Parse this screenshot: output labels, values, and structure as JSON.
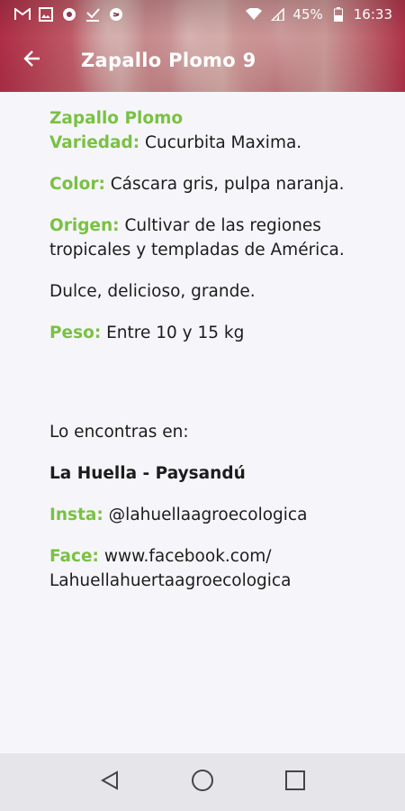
{
  "status_bar": {
    "battery": "45%",
    "time": "16:33",
    "icons": [
      "gmail-icon",
      "image-icon",
      "app-icon",
      "download-icon",
      "shazam-icon",
      "wifi-icon",
      "signal-icon",
      "battery-icon"
    ]
  },
  "appbar": {
    "title": "Zapallo Plomo 9"
  },
  "content": {
    "heading": "Zapallo Plomo",
    "variedad_label": "Variedad:",
    "variedad_value": " Cucurbita Maxima.",
    "color_label": "Color:",
    "color_value": " Cáscara gris, pulpa naranja.",
    "origen_label": "Origen:",
    "origen_value": " Cultivar de las regiones tropicales y templadas de América.",
    "description": "Dulce, delicioso, grande.",
    "peso_label": "Peso:",
    "peso_value": " Entre 10 y 15 kg",
    "found_in": "Lo encontras en:",
    "store": "La Huella - Paysandú",
    "insta_label": "Insta:",
    "insta_value": " @lahuellaagroecologica",
    "face_label": "Face:",
    "face_value_1": " www.facebook.com/",
    "face_value_2": "Lahuellahuertaagroecologica"
  },
  "colors": {
    "accent_green": "#7ac143",
    "header_red": "#b7304a"
  }
}
